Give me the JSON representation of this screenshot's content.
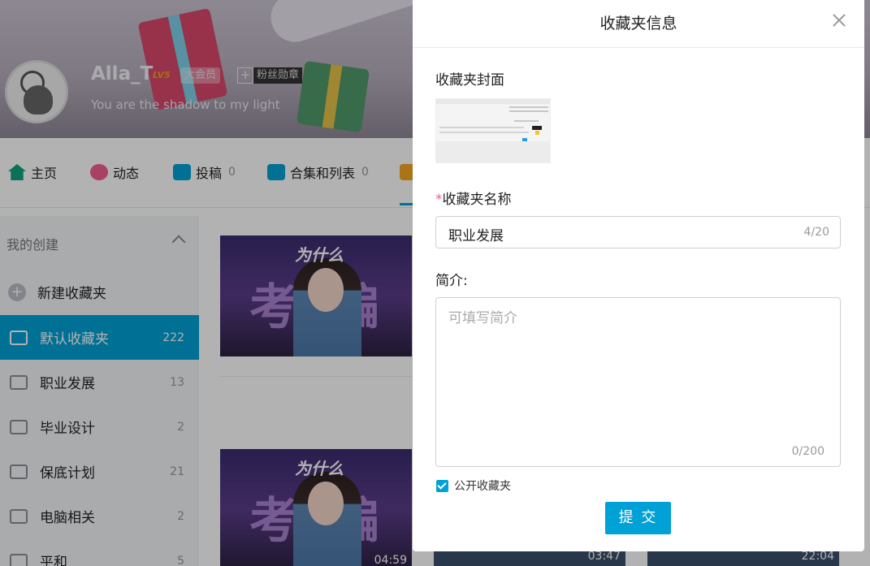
{
  "profile": {
    "username": "Alla_T",
    "level": "LV5",
    "vip_label": "大会员",
    "fan_badge_plus": "+",
    "fan_badge_label": "粉丝勋章",
    "signature": "You are the shadow to my light"
  },
  "nav": {
    "tabs": [
      {
        "label": "主页",
        "count": "",
        "icon": "home-icon",
        "color": "#11a37f"
      },
      {
        "label": "动态",
        "count": "",
        "icon": "activity-icon",
        "color": "#f25d8e"
      },
      {
        "label": "投稿",
        "count": "0",
        "icon": "upload-icon",
        "color": "#00a1d6"
      },
      {
        "label": "合集和列表",
        "count": "0",
        "icon": "collection-icon",
        "color": "#00a1d6"
      }
    ]
  },
  "sidebar": {
    "heading": "我的创建",
    "new_folder": "新建收藏夹",
    "folders": [
      {
        "label": "默认收藏夹",
        "count": "222",
        "active": true
      },
      {
        "label": "职业发展",
        "count": "13",
        "active": false
      },
      {
        "label": "毕业设计",
        "count": "2",
        "active": false
      },
      {
        "label": "保底计划",
        "count": "21",
        "active": false
      },
      {
        "label": "电脑相关",
        "count": "2",
        "active": false
      },
      {
        "label": "平和",
        "count": "5",
        "active": false
      }
    ]
  },
  "videos": [
    {
      "title_overlay": "为什么",
      "big_text": "考编",
      "duration": ""
    },
    {
      "title_overlay": "为什么",
      "big_text": "考编",
      "duration": "04:59"
    },
    {
      "duration": "03:47"
    },
    {
      "duration": "22:04"
    }
  ],
  "modal": {
    "title": "收藏夹信息",
    "cover_label": "收藏夹封面",
    "name_label": "收藏夹名称",
    "required_mark": "*",
    "name_value": "职业发展",
    "name_count": "4/20",
    "intro_label": "简介:",
    "intro_placeholder": "可填写简介",
    "intro_count": "0/200",
    "public_label": "公开收藏夹",
    "public_checked": true,
    "submit_label": "提 交"
  },
  "colors": {
    "accent": "#00a1d6",
    "required": "#f25d8e"
  }
}
